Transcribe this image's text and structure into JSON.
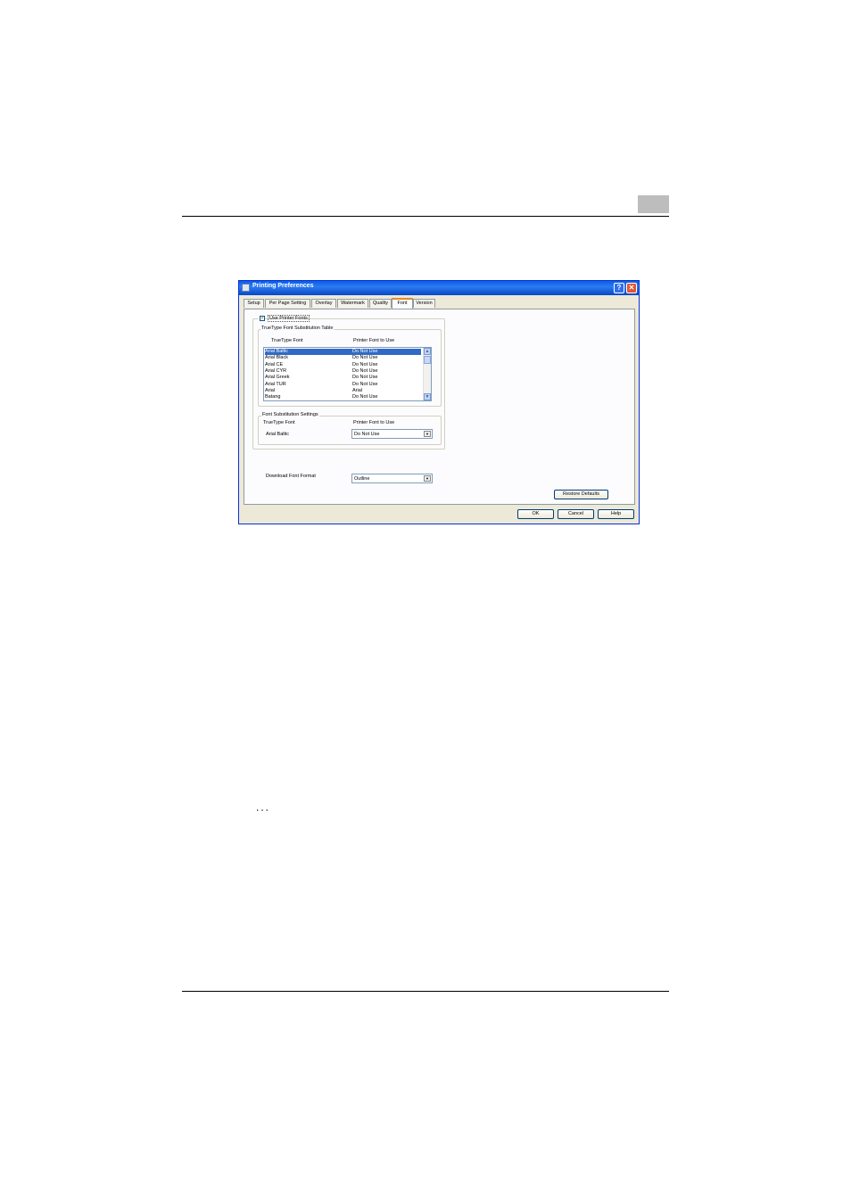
{
  "dialog": {
    "title": "Printing Preferences",
    "help_glyph": "?",
    "close_glyph": "✕",
    "tabs": [
      {
        "label": "Setup"
      },
      {
        "label": "Per Page Setting"
      },
      {
        "label": "Overlay"
      },
      {
        "label": "Watermark"
      },
      {
        "label": "Quality"
      },
      {
        "label": "Font",
        "active": true
      },
      {
        "label": "Version"
      }
    ],
    "use_printer_fonts": {
      "label": "Use Printer Fonts",
      "checked": true,
      "check_glyph": "✓"
    },
    "substitution_table": {
      "title": "TrueType Font Substitution Table",
      "col_truetype": "TrueType Font",
      "col_printer": "Printer Font to Use",
      "rows": [
        {
          "truetype": "Arial Baltic",
          "printer": "Do Not Use",
          "selected": true
        },
        {
          "truetype": "Arial Black",
          "printer": "Do Not Use"
        },
        {
          "truetype": "Arial CE",
          "printer": "Do Not Use"
        },
        {
          "truetype": "Arial CYR",
          "printer": "Do Not Use"
        },
        {
          "truetype": "Arial Greek",
          "printer": "Do Not Use"
        },
        {
          "truetype": "Arial TUR",
          "printer": "Do Not Use"
        },
        {
          "truetype": "Arial",
          "printer": "Arial"
        },
        {
          "truetype": "Batang",
          "printer": "Do Not Use"
        }
      ],
      "scroll_up_glyph": "▲",
      "scroll_down_glyph": "▼"
    },
    "substitution_settings": {
      "title": "Font Substitution Settings",
      "col_truetype": "TrueType Font",
      "col_printer": "Printer Font to Use",
      "current_font": "Arial Baltic",
      "printer_font_value": "Do Not Use"
    },
    "download_font_format": {
      "label": "Download Font Format",
      "value": "Outline"
    },
    "dropdown_glyph": "▼",
    "restore_defaults_label": "Restore Defaults",
    "ok_label": "OK",
    "cancel_label": "Cancel",
    "help_label": "Help"
  },
  "page": {
    "ellipsis": "..."
  }
}
